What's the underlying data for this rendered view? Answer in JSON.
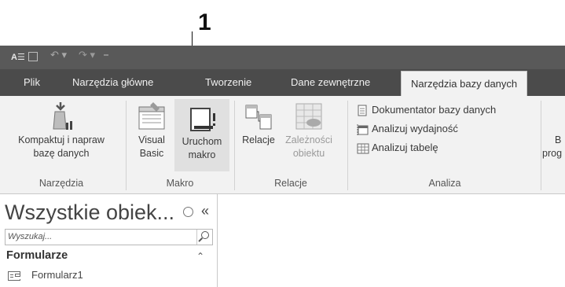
{
  "callout": {
    "number": "1"
  },
  "titlebar": {
    "app_icon": "A",
    "quick_access": [
      "save-icon",
      "undo-icon",
      "redo-icon",
      "customize-qat-icon"
    ]
  },
  "tabs": [
    {
      "label": "Plik",
      "active": false
    },
    {
      "label": "Narzędzia główne",
      "active": false
    },
    {
      "label": "Tworzenie",
      "active": false
    },
    {
      "label": "Dane zewnętrzne",
      "active": false
    },
    {
      "label": "Narzędzia bazy danych",
      "active": true
    }
  ],
  "ribbon": {
    "groups": {
      "narzedzia": {
        "label": "Narzędzia",
        "compact": {
          "line1": "Kompaktuj i napraw",
          "line2": "bazę danych",
          "icon": "compact-repair-icon"
        }
      },
      "makro": {
        "label": "Makro",
        "visual_basic": {
          "line1": "Visual",
          "line2": "Basic",
          "icon": "visual-basic-icon"
        },
        "run_macro": {
          "line1": "Uruchom",
          "line2": "makro",
          "icon": "run-macro-icon"
        }
      },
      "relacje": {
        "label": "Relacje",
        "relations": {
          "line1": "Relacje",
          "icon": "relationships-icon"
        },
        "dependencies": {
          "line1": "Zależności",
          "line2": "obiektu",
          "icon": "object-dependencies-icon"
        }
      },
      "analiza": {
        "label": "Analiza",
        "documenter": "Dokumentator bazy danych",
        "performance": "Analizuj wydajność",
        "table": "Analizuj tabelę"
      },
      "cut_off": {
        "line1": "B",
        "line2": "prog"
      }
    }
  },
  "nav": {
    "title": "Wszystkie obiek...",
    "collapse": "«",
    "search_placeholder": "Wyszukaj...",
    "group": "Formularze",
    "group_chevron": "⌃",
    "items": [
      {
        "label": "Formularz1",
        "icon": "form-icon"
      }
    ]
  }
}
